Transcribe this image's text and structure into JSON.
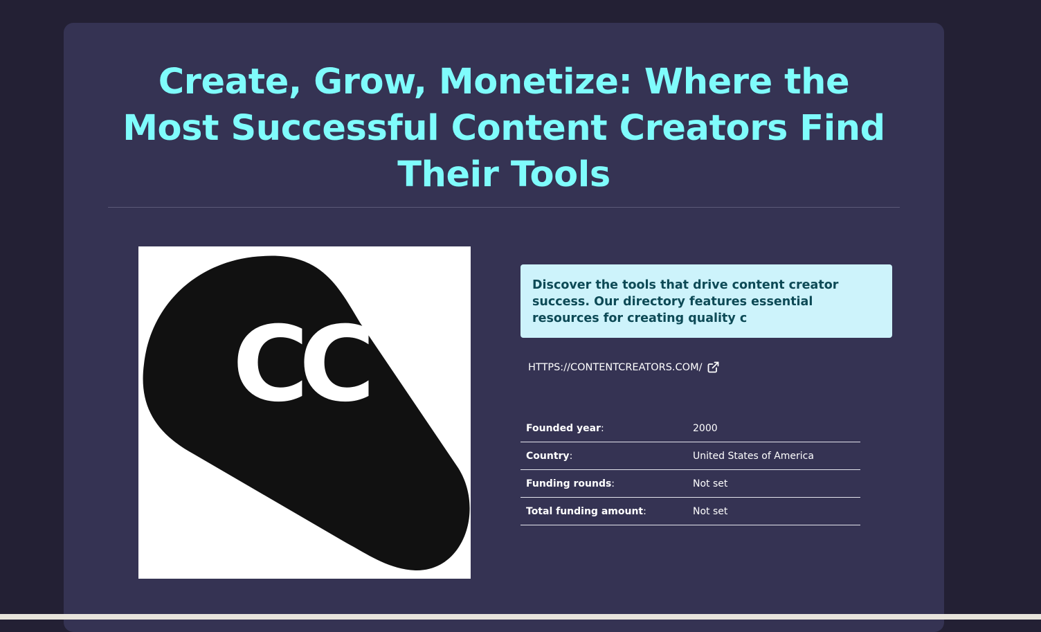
{
  "page": {
    "title": "Create, Grow, Monetize: Where the Most Successful Content Creators Find Their Tools"
  },
  "logo": {
    "text": "CC",
    "icon": "cc-logo-icon"
  },
  "description": {
    "text": "Discover the tools that drive content creator success. Our directory features essential resources for creating quality c"
  },
  "website": {
    "url": "HTTPS://CONTENTCREATORS.COM/",
    "icon": "external-link-icon"
  },
  "details": [
    {
      "label": "Founded year",
      "value": "2000"
    },
    {
      "label": "Country",
      "value": "United States of America"
    },
    {
      "label": "Funding rounds",
      "value": "Not set"
    },
    {
      "label": "Total funding amount",
      "value": "Not set"
    }
  ],
  "colors": {
    "background": "#232034",
    "card": "#353353",
    "title": "#7ffcfc",
    "description_bg": "#cdf3fb",
    "description_text": "#0d4a56"
  }
}
